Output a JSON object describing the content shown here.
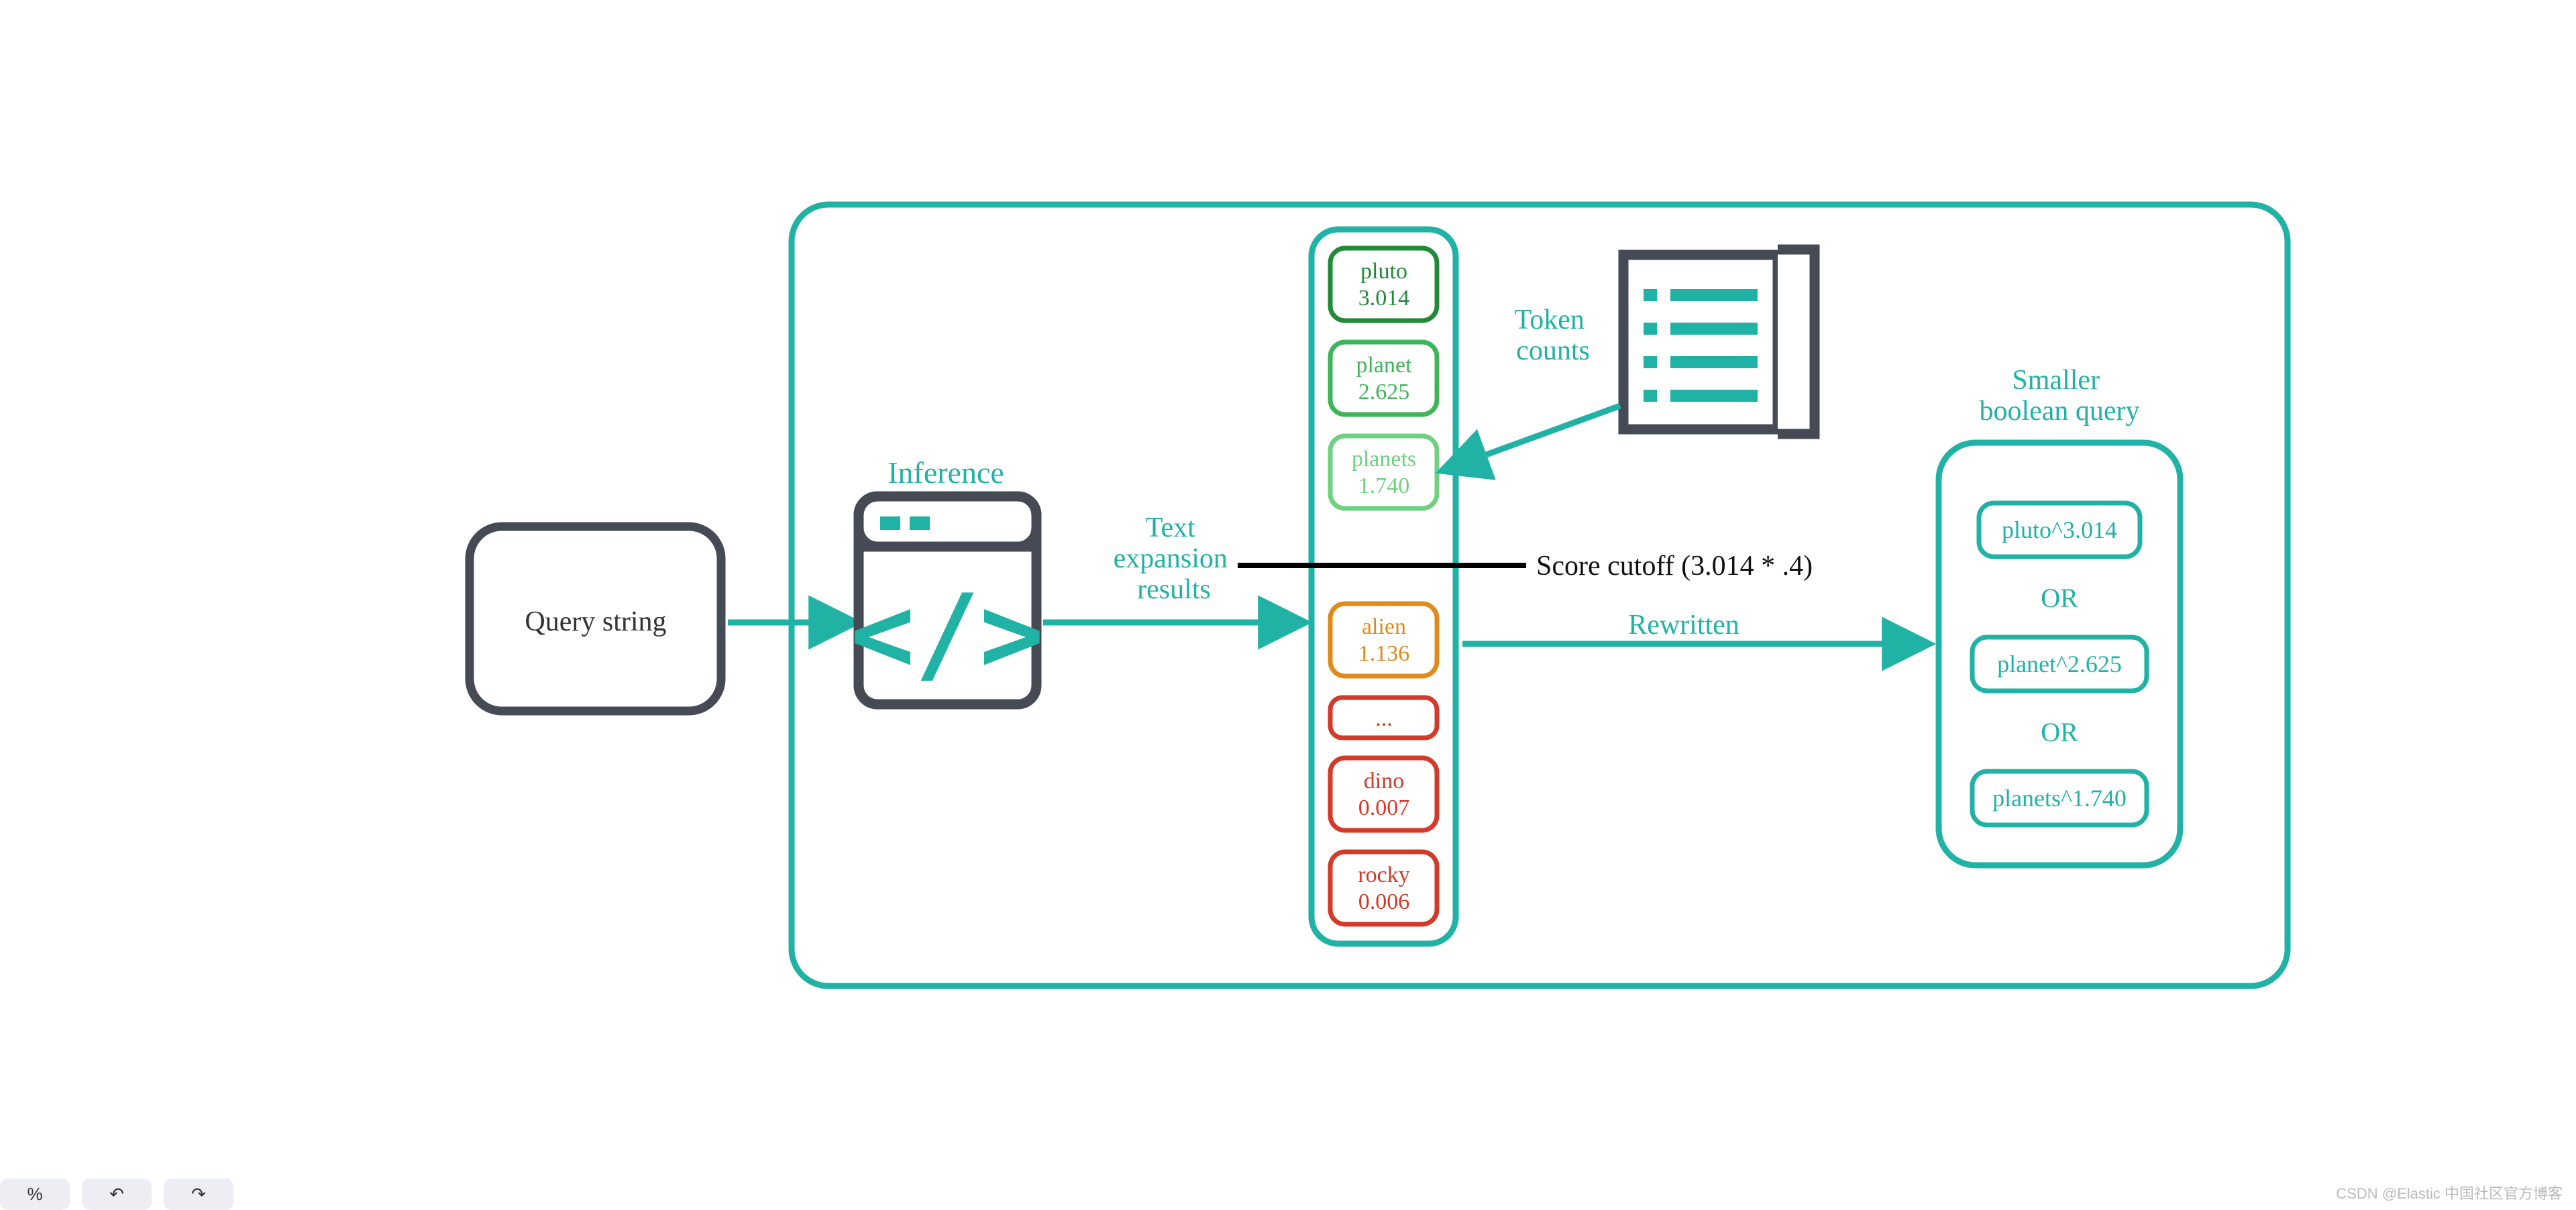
{
  "query_box": {
    "label": "Query string"
  },
  "inference": {
    "label": "Inference"
  },
  "arrows": {
    "text_expansion": "Text\nexpansion\nresults",
    "token_counts": "Token\ncounts",
    "rewritten": "Rewritten",
    "score_cutoff": "Score cutoff (3.014 * .4)"
  },
  "tokens": [
    {
      "name": "pluto",
      "score": "3.014",
      "color": "#228b3a"
    },
    {
      "name": "planet",
      "score": "2.625",
      "color": "#3fb55a"
    },
    {
      "name": "planets",
      "score": "1.740",
      "color": "#6fd17f"
    },
    {
      "name": "alien",
      "score": "1.136",
      "color": "#e08a1c"
    },
    {
      "name": "...",
      "score": "",
      "color": "#d43a2a",
      "ellipsis": true
    },
    {
      "name": "dino",
      "score": "0.007",
      "color": "#d43a2a"
    },
    {
      "name": "rocky",
      "score": "0.006",
      "color": "#d43a2a"
    }
  ],
  "output": {
    "title": "Smaller\nboolean query",
    "items": [
      "pluto^3.014",
      "planet^2.625",
      "planets^1.740"
    ],
    "join": "OR"
  },
  "footer": {
    "brand": "CSDN @Elastic 中国社区官方博客"
  },
  "toolbar": {
    "zoom": "%",
    "undo": "↶",
    "redo": "↷"
  }
}
